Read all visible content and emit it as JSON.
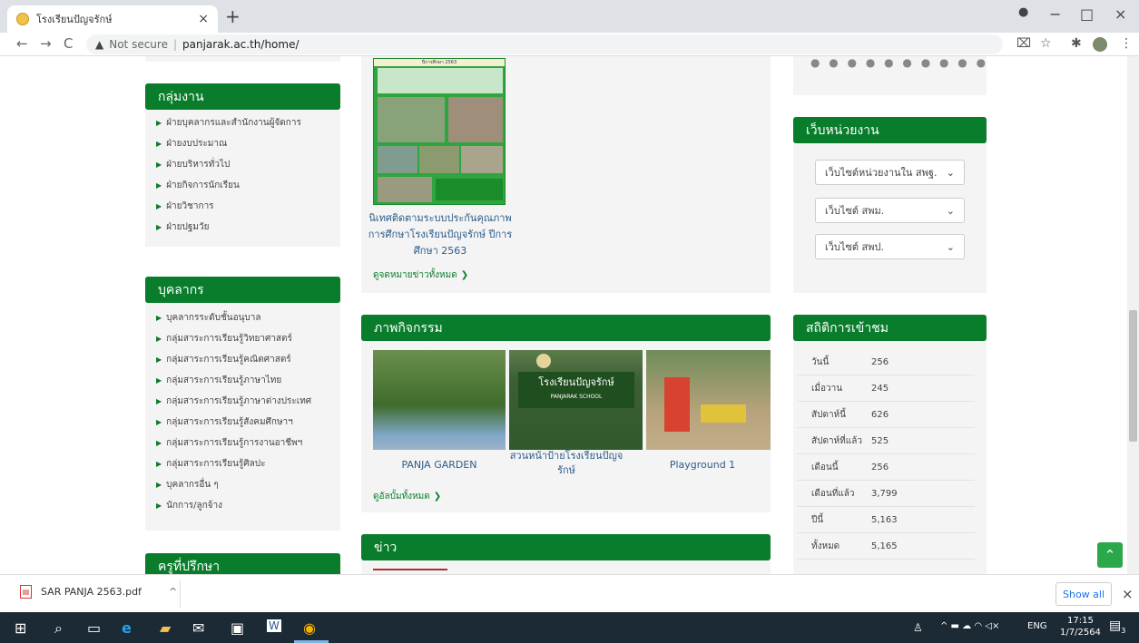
{
  "browser": {
    "tab_title": "โรงเรียนปัญจรักษ์",
    "new_tab": "+",
    "tab_close": "×",
    "not_secure": "Not secure",
    "url": "panjarak.ac.th/home/",
    "back": "←",
    "forward": "→",
    "reload": "C",
    "warn_icon": "▲",
    "win_min": "−",
    "win_max": "□",
    "win_close": "×"
  },
  "sidebar": {
    "groups_title": "กลุ่มงาน",
    "groups": [
      "ฝ่ายบุคลากรและสำนักงานผู้จัดการ",
      "ฝ่ายงบประมาณ",
      "ฝ่ายบริหารทั่วไป",
      "ฝ่ายกิจการนักเรียน",
      "ฝ่ายวิชาการ",
      "ฝ่ายปฐมวัย"
    ],
    "personnel_title": "บุคลากร",
    "personnel": [
      "บุคลากรระดับชั้นอนุบาล",
      "กลุ่มสาระการเรียนรู้วิทยาศาสตร์",
      "กลุ่มสาระการเรียนรู้คณิตศาสตร์",
      "กลุ่มสาระการเรียนรู้ภาษาไทย",
      "กลุ่มสาระการเรียนรู้ภาษาต่างประเทศ",
      "กลุ่มสาระการเรียนรู้สังคมศึกษาฯ",
      "กลุ่มสาระการเรียนรู้การงานอาชีพฯ",
      "กลุ่มสาระการเรียนรู้ศิลปะ",
      "บุคลากรอื่น ๆ",
      "นักการ/ลูกจ้าง"
    ],
    "advisor_title": "ครูที่ปรึกษา"
  },
  "main": {
    "poster_header": "ปีการศึกษา 2563",
    "news_caption": "นิเทศติดตามระบบประกันคุณภาพการศึกษาโรงเรียนปัญจรักษ์ ปีการศึกษา 2563",
    "news_more": "ดูจดหมายข่าวทั้งหมด",
    "activities_title": "ภาพกิจกรรม",
    "sign_text": "โรงเรียนปัญจรักษ์",
    "sign_sub": "PANJARAK SCHOOL",
    "activities": [
      {
        "caption": "PANJA GARDEN"
      },
      {
        "caption": "สวนหน้าป้ายโรงเรียนปัญจรักษ์"
      },
      {
        "caption": "Playground 1"
      }
    ],
    "albums_more": "ดูอัลบั้มทั้งหมด",
    "news_title": "ข่าว"
  },
  "right": {
    "dots": "● ● ● ● ● ● ● ● ● ●",
    "links_title": "เว็บหน่วยงาน",
    "selects": [
      "เว็บไซต์หน่วยงานใน สพฐ.",
      "เว็บไซต์ สพม.",
      "เว็บไซต์ สพป."
    ],
    "stats_title": "สถิติการเข้าชม",
    "stats": [
      {
        "label": "วันนี้",
        "value": "256"
      },
      {
        "label": "เมื่อวาน",
        "value": "245"
      },
      {
        "label": "สัปดาห์นี้",
        "value": "626"
      },
      {
        "label": "สัปดาห์ที่แล้ว",
        "value": "525"
      },
      {
        "label": "เดือนนี้",
        "value": "256"
      },
      {
        "label": "เดือนที่แล้ว",
        "value": "3,799"
      },
      {
        "label": "ปีนี้",
        "value": "5,163"
      },
      {
        "label": "ทั้งหมด",
        "value": "5,165"
      }
    ]
  },
  "downloads": {
    "file": "SAR PANJA 2563.pdf",
    "chevron": "^",
    "show_all": "Show all",
    "close": "×"
  },
  "taskbar": {
    "lang": "ENG",
    "time": "17:15",
    "date": "1/7/2564",
    "notif_count": "3"
  },
  "colors": {
    "accent": "#0a7d2c",
    "scroll_top": "#2aa84a"
  }
}
